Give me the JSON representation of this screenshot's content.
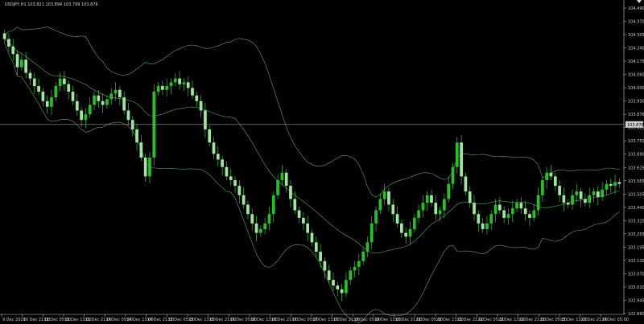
{
  "symbol_line": "USDJPY,H1  103.821 103.894 103.799 103.876",
  "current_price": "103.876",
  "price_axis_labels": [
    "104.490",
    "104.370",
    "104.305",
    "104.240",
    "104.175",
    "104.060",
    "104.000",
    "103.930",
    "103.876",
    "103.815",
    "103.750",
    "103.690",
    "103.625",
    "103.565",
    "103.505",
    "103.440",
    "103.320",
    "103.255",
    "103.195",
    "103.130",
    "103.070",
    "103.010",
    "102.945",
    "102.880"
  ],
  "time_axis_labels": [
    "9 Dec 2020",
    "10 Dec 21:00",
    "11 Dec 05:00",
    "11 Dec 13:00",
    "11 Dec 21:00",
    "14 Dec 05:00",
    "14 Dec 13:00",
    "14 Dec 21:00",
    "15 Dec 05:00",
    "15 Dec 13:00",
    "15 Dec 21:00",
    "16 Dec 05:00",
    "16 Dec 13:00",
    "16 Dec 21:00",
    "17 Dec 05:00",
    "17 Dec 13:00",
    "17 Dec 21:00",
    "18 Dec 05:00",
    "18 Dec 13:00",
    "18 Dec 21:00",
    "21 Dec 05:00",
    "21 Dec 13:00",
    "21 Dec 21:00",
    "22 Dec 05:00",
    "22 Dec 13:00",
    "22 Dec 21:00",
    "23 Dec 05:00",
    "23 Dec 13:00",
    "23 Dec 21:00",
    "24 Dec 05:00"
  ],
  "colors": {
    "background": "#000000",
    "bull": "#22c422",
    "bear": "#9ee89e",
    "wick": "#3fbf3f",
    "band": "#5ea85e",
    "axis": "#cfcfcf",
    "price_line": "#9a9a9a"
  },
  "chart_data": {
    "type": "candlestick",
    "ylim": [
      102.88,
      104.52
    ],
    "overlay": "Bollinger Bands",
    "close": [
      104.33,
      104.29,
      104.25,
      104.18,
      104.22,
      104.15,
      104.12,
      104.08,
      104.05,
      104.0,
      103.97,
      104.02,
      104.08,
      104.12,
      104.09,
      104.05,
      104.0,
      103.95,
      103.9,
      103.93,
      103.98,
      104.03,
      104.0,
      103.98,
      104.01,
      104.04,
      104.06,
      104.02,
      103.95,
      103.9,
      103.85,
      103.78,
      103.7,
      103.6,
      103.7,
      104.05,
      104.08,
      104.06,
      104.08,
      104.1,
      104.12,
      104.09,
      104.1,
      104.07,
      104.03,
      104.0,
      103.95,
      103.85,
      103.78,
      103.72,
      103.69,
      103.65,
      103.6,
      103.58,
      103.55,
      103.5,
      103.45,
      103.4,
      103.35,
      103.3,
      103.32,
      103.35,
      103.4,
      103.5,
      103.58,
      103.62,
      103.55,
      103.48,
      103.42,
      103.38,
      103.35,
      103.3,
      103.25,
      103.2,
      103.15,
      103.1,
      103.05,
      103.02,
      103.0,
      102.98,
      103.05,
      103.1,
      103.12,
      103.15,
      103.2,
      103.25,
      103.35,
      103.42,
      103.48,
      103.52,
      103.45,
      103.4,
      103.35,
      103.3,
      103.28,
      103.32,
      103.38,
      103.42,
      103.46,
      103.5,
      103.46,
      103.4,
      103.42,
      103.48,
      103.56,
      103.65,
      103.78,
      103.6,
      103.52,
      103.46,
      103.4,
      103.35,
      103.32,
      103.35,
      103.4,
      103.45,
      103.42,
      103.38,
      103.4,
      103.43,
      103.46,
      103.43,
      103.4,
      103.38,
      103.42,
      103.5,
      103.58,
      103.62,
      103.6,
      103.55,
      103.5,
      103.46,
      103.45,
      103.5,
      103.52,
      103.48,
      103.46,
      103.5,
      103.52,
      103.49,
      103.53,
      103.56,
      103.55,
      103.57,
      103.56
    ]
  }
}
